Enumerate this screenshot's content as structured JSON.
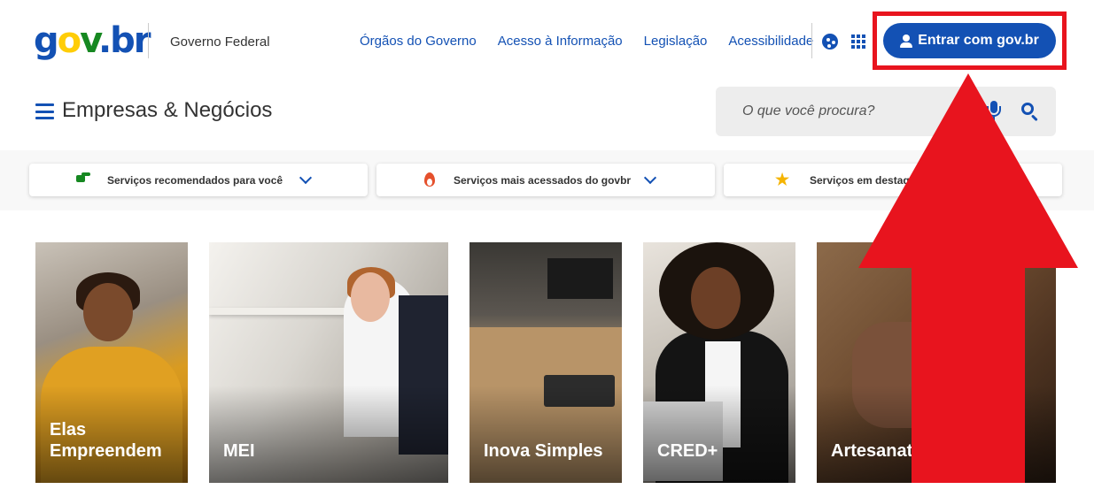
{
  "header": {
    "logo_text": {
      "g": "g",
      "o": "o",
      "v": "v",
      "dot": ".",
      "br": "br"
    },
    "government_label": "Governo Federal",
    "nav_links": [
      {
        "label": "Órgãos do Governo"
      },
      {
        "label": "Acesso à Informação"
      },
      {
        "label": "Legislação"
      },
      {
        "label": "Acessibilidade"
      }
    ],
    "login_label": "Entrar com gov.br",
    "colors": {
      "primary": "#1351b4",
      "highlight_border": "#e8141e"
    }
  },
  "section": {
    "title": "Empresas & Negócios"
  },
  "search": {
    "placeholder": "O que você procura?"
  },
  "services": [
    {
      "label": "Serviços recomendados para você",
      "icon": "thumbs-up-icon"
    },
    {
      "label": "Serviços mais acessados do govbr",
      "icon": "fire-icon"
    },
    {
      "label": "Serviços em destaque",
      "icon": "star-icon"
    }
  ],
  "cards": [
    {
      "title": "Elas Empreendem"
    },
    {
      "title": "MEI"
    },
    {
      "title": "Inova Simples"
    },
    {
      "title": "CRED+"
    },
    {
      "title": "Artesanato"
    }
  ],
  "annotation": {
    "arrow_color": "#e8141e",
    "target": "login-button"
  }
}
